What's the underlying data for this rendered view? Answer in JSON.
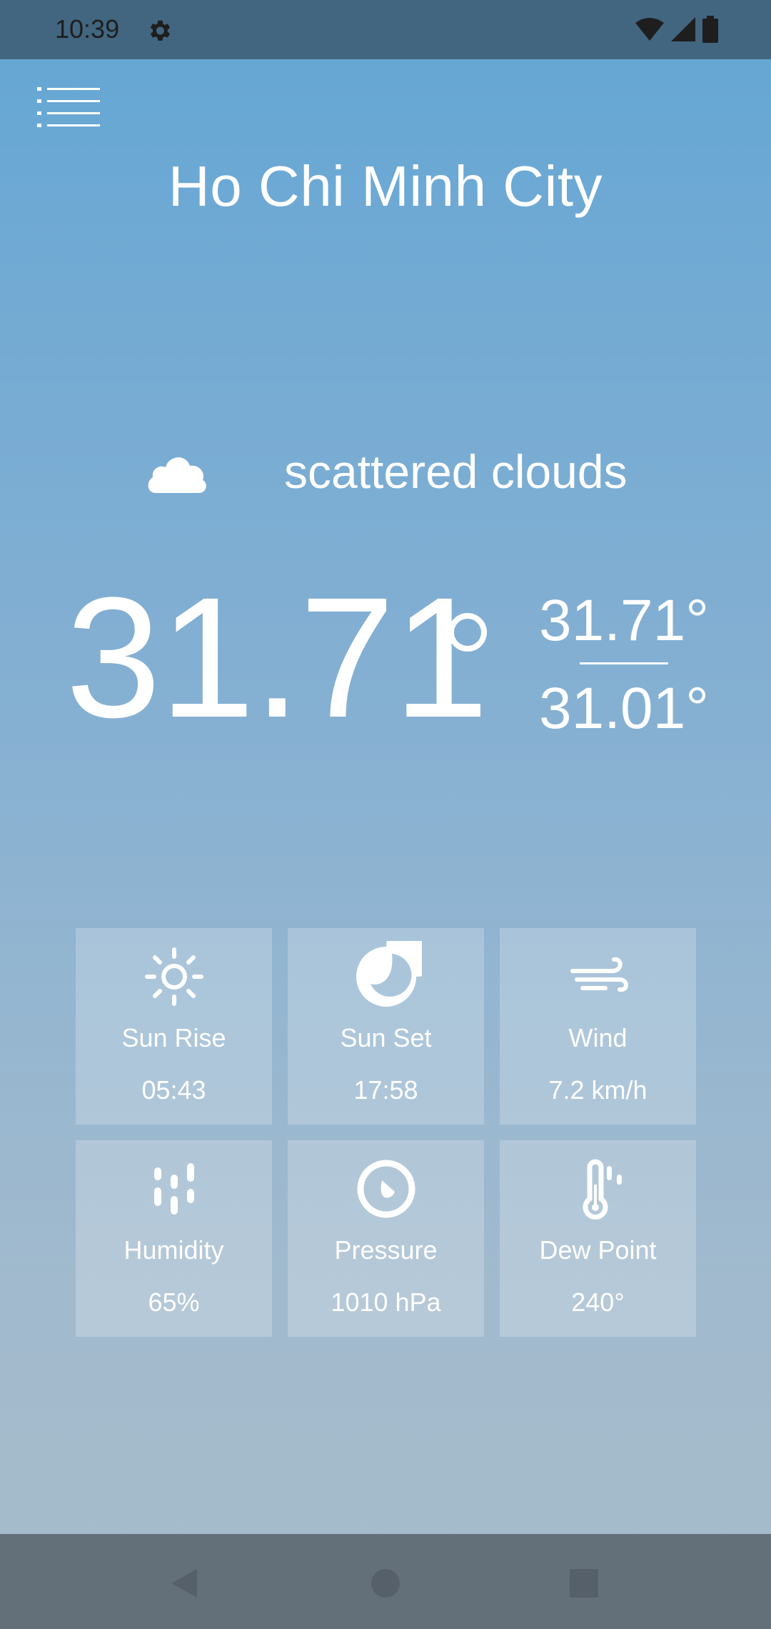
{
  "status_bar": {
    "time": "10:39"
  },
  "city": "Ho Chi Minh City",
  "condition": {
    "text": "scattered clouds",
    "icon": "cloud-icon"
  },
  "temperature": {
    "current": "31.71",
    "high": "31.71°",
    "low": "31.01°"
  },
  "details": [
    {
      "label": "Sun Rise",
      "value": "05:43",
      "icon": "sun-icon"
    },
    {
      "label": "Sun Set",
      "value": "17:58",
      "icon": "moon-icon"
    },
    {
      "label": "Wind",
      "value": "7.2 km/h",
      "icon": "wind-icon"
    },
    {
      "label": "Humidity",
      "value": "65%",
      "icon": "humidity-icon"
    },
    {
      "label": "Pressure",
      "value": "1010 hPa",
      "icon": "pressure-icon"
    },
    {
      "label": "Dew Point",
      "value": "240°",
      "icon": "thermometer-icon"
    }
  ],
  "colors": {
    "status_bar": "#42667f",
    "nav_bar": "#647079",
    "gradient_top": "#63a6d4",
    "gradient_bottom": "#a6bccc"
  }
}
